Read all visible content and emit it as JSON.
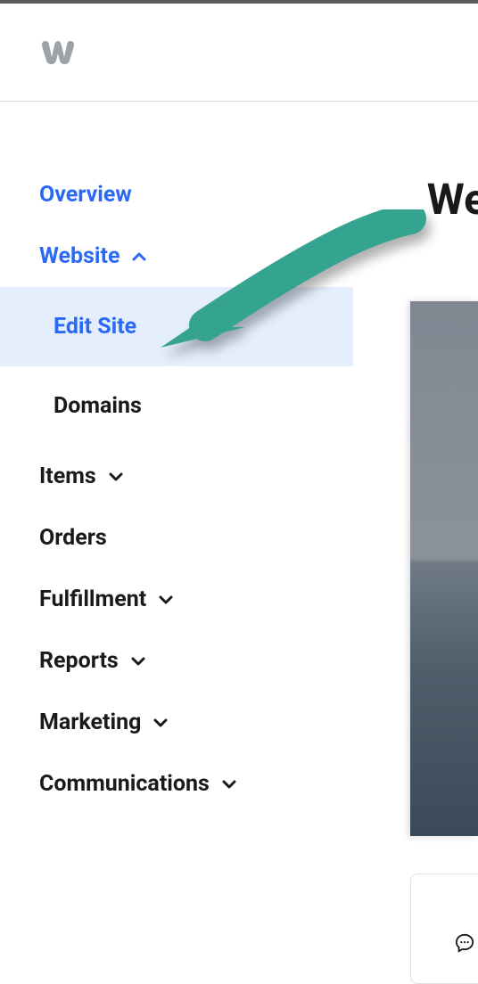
{
  "header": {
    "logo_name": "weebly-logo"
  },
  "sidebar": {
    "overview": "Overview",
    "website": {
      "label": "Website",
      "expanded": true
    },
    "website_sub": {
      "edit_site": "Edit Site",
      "domains": "Domains"
    },
    "items": {
      "label": "Items",
      "expanded": false
    },
    "orders": "Orders",
    "fulfillment": {
      "label": "Fulfillment",
      "expanded": false
    },
    "reports": {
      "label": "Reports",
      "expanded": false
    },
    "marketing": {
      "label": "Marketing",
      "expanded": false
    },
    "communications": {
      "label": "Communications",
      "expanded": false
    }
  },
  "main": {
    "title_fragment": "We"
  }
}
